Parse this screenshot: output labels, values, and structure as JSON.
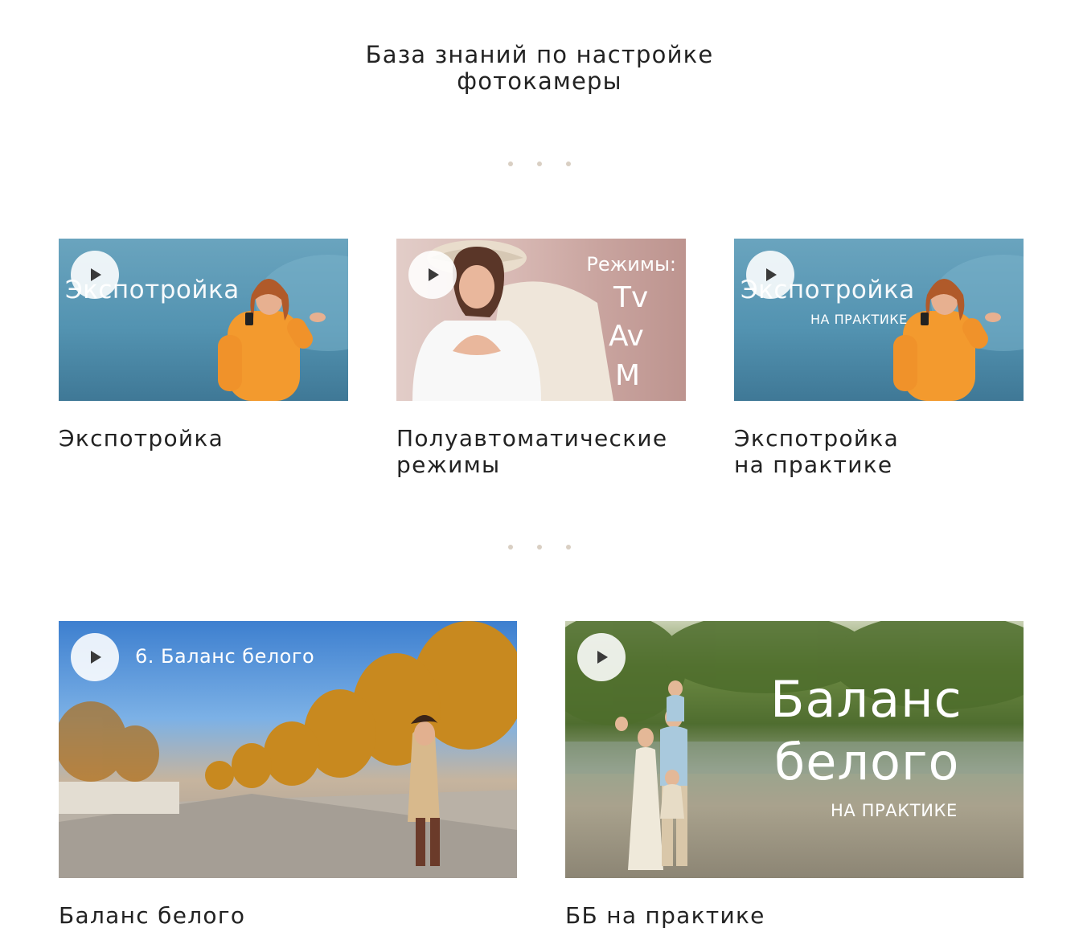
{
  "header": {
    "title_line1": "База знаний по настройке",
    "title_line2": "фотокамеры"
  },
  "videos_row1": [
    {
      "title_lines": [
        "Экспотройка"
      ],
      "overlay_lines": [
        "Экспотройка"
      ],
      "play_icon": "play-icon"
    },
    {
      "title_lines": [
        "Полуавтоматические",
        "режимы"
      ],
      "overlay_lines": [
        "Режимы:",
        "Tv",
        "Av",
        "M"
      ],
      "play_icon": "play-icon"
    },
    {
      "title_lines": [
        "Экспотройка",
        "на практике"
      ],
      "overlay_lines": [
        "Экспотройка",
        "НА ПРАКТИКЕ"
      ],
      "play_icon": "play-icon"
    }
  ],
  "videos_row2": [
    {
      "title_lines": [
        "Баланс белого"
      ],
      "overlay_lines": [
        "6. Баланс белого"
      ],
      "play_icon": "play-icon"
    },
    {
      "title_lines": [
        "ББ на практике"
      ],
      "overlay_lines": [
        "Баланс",
        "белого",
        "НА ПРАКТИКЕ"
      ],
      "play_icon": "play-icon"
    }
  ],
  "colors": {
    "dot": "#d9cfc3",
    "text": "#222222",
    "play_bg": "#ffffff",
    "play_triangle": "#3a3a3a"
  }
}
